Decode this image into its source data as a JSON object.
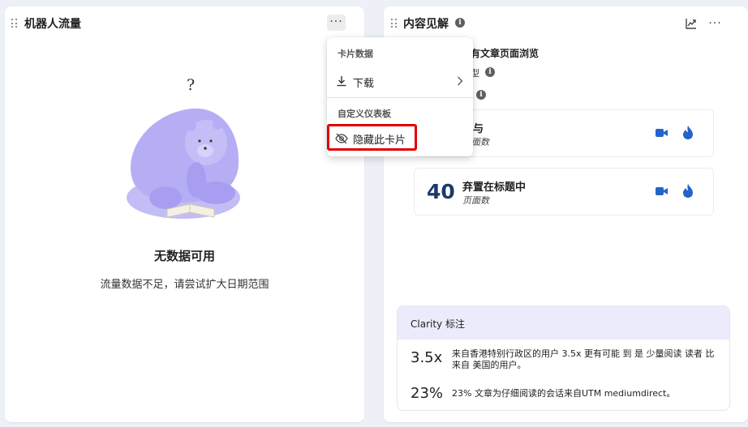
{
  "left_card": {
    "title": "机器人流量",
    "more_label": "···",
    "question_mark": "?",
    "no_data_title": "无数据可用",
    "no_data_description": "流量数据不足，请尝试扩大日期范围"
  },
  "card_menu": {
    "section_card_data": "卡片数据",
    "download_label": "下载",
    "section_custom_dashboard": "自定义仪表板",
    "hide_card_label": "隐藏此卡片"
  },
  "right_card": {
    "title": "内容见解",
    "more_label": "···",
    "article_views_label": "有文章页面浏览",
    "truncated_line_1": "型",
    "metrics": [
      {
        "number": "",
        "title": "参与",
        "subtitle": "页面数"
      },
      {
        "number": "40",
        "title": "弃置在标题中",
        "subtitle": "页面数"
      }
    ],
    "clarity": {
      "title": "Clarity 标注",
      "insights": [
        {
          "number": "3.5x",
          "text": "来自香港特别行政区的用户 3.5x 更有可能 到 是 少量阅读 读者 比来自 美国的用户。"
        },
        {
          "number": "23%",
          "text": "23% 文章为仔细阅读的会话来自UTM mediumdirect。"
        }
      ]
    }
  },
  "colors": {
    "background": "#eef0f8",
    "accent_blue": "#2563c9",
    "highlight_red": "#e00000",
    "clarity_header": "#ecebfb",
    "bear_purple": "#b5aef5"
  }
}
